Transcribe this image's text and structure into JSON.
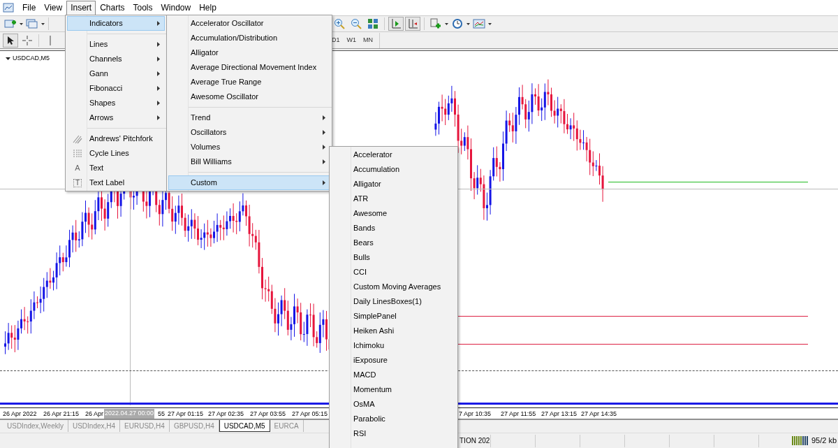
{
  "menu_bar": [
    {
      "label": "File",
      "selected": false
    },
    {
      "label": "View",
      "selected": false
    },
    {
      "label": "Insert",
      "selected": true
    },
    {
      "label": "Charts",
      "selected": false
    },
    {
      "label": "Tools",
      "selected": false
    },
    {
      "label": "Window",
      "selected": false
    },
    {
      "label": "Help",
      "selected": false
    }
  ],
  "timeframes": [
    "D1",
    "W1",
    "MN"
  ],
  "chart": {
    "symbol": "USDCAD,M5",
    "crosshair_label": "2022.04.27 00:00",
    "time_labels": [
      {
        "label": "26 Apr 2022"
      },
      {
        "label": "26 Apr 21:15"
      },
      {
        "label": "26 Apr"
      },
      {
        "label": "55"
      },
      {
        "label": "27 Apr 01:15"
      },
      {
        "label": "27 Apr 02:35"
      },
      {
        "label": "27 Apr 03:55"
      },
      {
        "label": "27 Apr 05:15"
      },
      {
        "label": "7 Apr 10:35"
      },
      {
        "label": "27 Apr 11:55"
      },
      {
        "label": "27 Apr 13:15"
      },
      {
        "label": "27 Apr 14:35"
      }
    ]
  },
  "insert_menu": [
    [
      {
        "label": "Indicators",
        "submenu": true,
        "highlighted": true
      }
    ],
    [
      {
        "label": "Lines",
        "submenu": true,
        "highlighted": false
      },
      {
        "label": "Channels",
        "submenu": true,
        "highlighted": false
      },
      {
        "label": "Gann",
        "submenu": true,
        "highlighted": false
      },
      {
        "label": "Fibonacci",
        "submenu": true,
        "highlighted": false
      },
      {
        "label": "Shapes",
        "submenu": true,
        "highlighted": false
      },
      {
        "label": "Arrows",
        "submenu": true,
        "highlighted": false
      }
    ],
    [
      {
        "label": "Andrews' Pitchfork",
        "submenu": false,
        "highlighted": false,
        "kind": "pitchfork"
      },
      {
        "label": "Cycle Lines",
        "submenu": false,
        "highlighted": false,
        "kind": "cycles"
      },
      {
        "label": "Text",
        "submenu": false,
        "highlighted": false,
        "kind": "glyph",
        "glyph": "A"
      },
      {
        "label": "Text Label",
        "submenu": false,
        "highlighted": false,
        "kind": "boxed",
        "glyph": "T"
      }
    ]
  ],
  "indicators_menu": [
    [
      {
        "label": "Accelerator Oscillator",
        "submenu": false,
        "highlighted": false
      },
      {
        "label": "Accumulation/Distribution",
        "submenu": false,
        "highlighted": false
      },
      {
        "label": "Alligator",
        "submenu": false,
        "highlighted": false
      },
      {
        "label": "Average Directional Movement Index",
        "submenu": false,
        "highlighted": false
      },
      {
        "label": "Average True Range",
        "submenu": false,
        "highlighted": false
      },
      {
        "label": "Awesome Oscillator",
        "submenu": false,
        "highlighted": false
      }
    ],
    [
      {
        "label": "Trend",
        "submenu": true,
        "highlighted": false
      },
      {
        "label": "Oscillators",
        "submenu": true,
        "highlighted": false
      },
      {
        "label": "Volumes",
        "submenu": true,
        "highlighted": false
      },
      {
        "label": "Bill Williams",
        "submenu": true,
        "highlighted": false
      }
    ],
    [
      {
        "label": "Custom",
        "submenu": true,
        "highlighted": true
      }
    ]
  ],
  "custom_menu": [
    [
      {
        "label": "Accelerator",
        "submenu": false,
        "highlighted": false
      },
      {
        "label": "Accumulation",
        "submenu": false,
        "highlighted": false
      },
      {
        "label": "Alligator",
        "submenu": false,
        "highlighted": false
      },
      {
        "label": "ATR",
        "submenu": false,
        "highlighted": false
      },
      {
        "label": "Awesome",
        "submenu": false,
        "highlighted": false
      },
      {
        "label": "Bands",
        "submenu": false,
        "highlighted": false
      },
      {
        "label": "Bears",
        "submenu": false,
        "highlighted": false
      },
      {
        "label": "Bulls",
        "submenu": false,
        "highlighted": false
      },
      {
        "label": "CCI",
        "submenu": false,
        "highlighted": false
      },
      {
        "label": "Custom Moving Averages",
        "submenu": false,
        "highlighted": false
      },
      {
        "label": "Daily LinesBoxes(1)",
        "submenu": false,
        "highlighted": false
      },
      {
        "label": "SimplePanel",
        "submenu": false,
        "highlighted": false
      },
      {
        "label": "Heiken Ashi",
        "submenu": false,
        "highlighted": false
      },
      {
        "label": "Ichimoku",
        "submenu": false,
        "highlighted": false
      },
      {
        "label": "iExposure",
        "submenu": false,
        "highlighted": false
      },
      {
        "label": "MACD",
        "submenu": false,
        "highlighted": false
      },
      {
        "label": "Momentum",
        "submenu": false,
        "highlighted": false
      },
      {
        "label": "OsMA",
        "submenu": false,
        "highlighted": false
      },
      {
        "label": "Parabolic",
        "submenu": false,
        "highlighted": false
      },
      {
        "label": "RSI",
        "submenu": false,
        "highlighted": false
      }
    ]
  ],
  "chart_tabs": [
    {
      "label": "USDIndex,Weekly",
      "selected": false
    },
    {
      "label": "USDIndex,H4",
      "selected": false
    },
    {
      "label": "EURUSD,H4",
      "selected": false
    },
    {
      "label": "GBPUSD,H4",
      "selected": false
    },
    {
      "label": "USDCAD,M5",
      "selected": true
    },
    {
      "label": "EURCA",
      "selected": false
    }
  ],
  "status_bar": {
    "profile": "TION 202",
    "traffic": "95/2 kb"
  }
}
